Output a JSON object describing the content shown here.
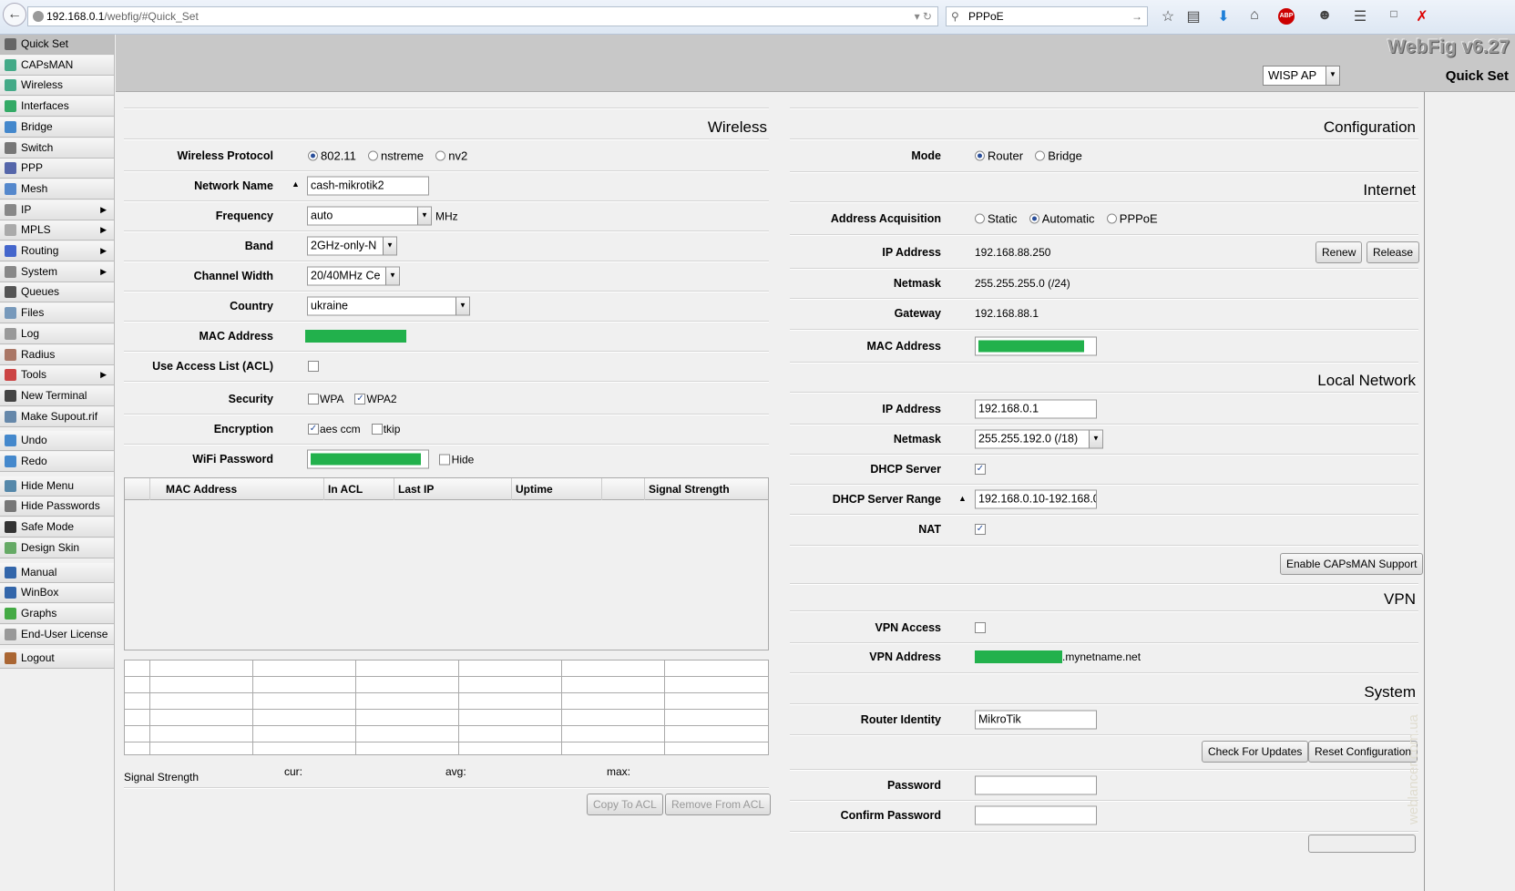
{
  "browser": {
    "url_host": "192.168.0.1",
    "url_path": "/webfig/#Quick_Set",
    "search": "PPPoE",
    "abp": "ABP"
  },
  "sidebar": {
    "items": [
      {
        "label": "Quick Set",
        "active": true
      },
      {
        "label": "CAPsMAN"
      },
      {
        "label": "Wireless"
      },
      {
        "label": "Interfaces"
      },
      {
        "label": "Bridge"
      },
      {
        "label": "Switch"
      },
      {
        "label": "PPP"
      },
      {
        "label": "Mesh"
      },
      {
        "label": "IP",
        "submenu": true
      },
      {
        "label": "MPLS",
        "submenu": true
      },
      {
        "label": "Routing",
        "submenu": true
      },
      {
        "label": "System",
        "submenu": true
      },
      {
        "label": "Queues"
      },
      {
        "label": "Files"
      },
      {
        "label": "Log"
      },
      {
        "label": "Radius"
      },
      {
        "label": "Tools",
        "submenu": true
      },
      {
        "label": "New Terminal"
      },
      {
        "label": "Make Supout.rif"
      },
      {
        "label": "Undo"
      },
      {
        "label": "Redo"
      },
      {
        "label": "Hide Menu"
      },
      {
        "label": "Hide Passwords"
      },
      {
        "label": "Safe Mode"
      },
      {
        "label": "Design Skin"
      },
      {
        "label": "Manual"
      },
      {
        "label": "WinBox"
      },
      {
        "label": "Graphs"
      },
      {
        "label": "End-User License"
      },
      {
        "label": "Logout"
      }
    ]
  },
  "header": {
    "brand": "WebFig v6.27",
    "mode": "WISP AP",
    "title": "Quick Set"
  },
  "wireless": {
    "title": "Wireless",
    "protocol_label": "Wireless Protocol",
    "protocols": [
      "802.11",
      "nstreme",
      "nv2"
    ],
    "network_name_label": "Network Name",
    "network_name": "cash-mikrotik2",
    "frequency_label": "Frequency",
    "frequency": "auto",
    "frequency_unit": "MHz",
    "band_label": "Band",
    "band": "2GHz-only-N",
    "channel_width_label": "Channel Width",
    "channel_width": "20/40MHz Ce",
    "country_label": "Country",
    "country": "ukraine",
    "mac_label": "MAC Address",
    "acl_label": "Use Access List (ACL)",
    "security_label": "Security",
    "security": [
      "WPA",
      "WPA2"
    ],
    "encryption_label": "Encryption",
    "encryption": [
      "aes ccm",
      "tkip"
    ],
    "password_label": "WiFi Password",
    "hide_label": "Hide",
    "table_headers": [
      "MAC Address",
      "In ACL",
      "Last IP",
      "Uptime",
      "Signal Strength"
    ],
    "signal_label": "Signal Strength",
    "cur": "cur:",
    "avg": "avg:",
    "max": "max:",
    "copy_btn": "Copy To ACL",
    "remove_btn": "Remove From ACL"
  },
  "config": {
    "title": "Configuration",
    "mode_label": "Mode",
    "modes": [
      "Router",
      "Bridge"
    ]
  },
  "internet": {
    "title": "Internet",
    "acq_label": "Address Acquisition",
    "acq": [
      "Static",
      "Automatic",
      "PPPoE"
    ],
    "ip_label": "IP Address",
    "ip": "192.168.88.250",
    "renew": "Renew",
    "release": "Release",
    "netmask_label": "Netmask",
    "netmask": "255.255.255.0 (/24)",
    "gateway_label": "Gateway",
    "gateway": "192.168.88.1",
    "mac_label": "MAC Address"
  },
  "local": {
    "title": "Local Network",
    "ip_label": "IP Address",
    "ip": "192.168.0.1",
    "netmask_label": "Netmask",
    "netmask": "255.255.192.0 (/18)",
    "dhcp_label": "DHCP Server",
    "range_label": "DHCP Server Range",
    "range": "192.168.0.10-192.168.0.:",
    "nat_label": "NAT",
    "capsman_btn": "Enable CAPsMAN Support"
  },
  "vpn": {
    "title": "VPN",
    "access_label": "VPN Access",
    "address_label": "VPN Address",
    "address_suffix": ".mynetname.net"
  },
  "system": {
    "title": "System",
    "identity_label": "Router Identity",
    "identity": "MikroTik",
    "check_btn": "Check For Updates",
    "reset_btn": "Reset Configuration",
    "password_label": "Password",
    "confirm_label": "Confirm Password"
  },
  "watermark": "weblancer.com.ua",
  "colors": {
    "redacted": "#22b14c",
    "topbar": "#c8c8c8"
  }
}
